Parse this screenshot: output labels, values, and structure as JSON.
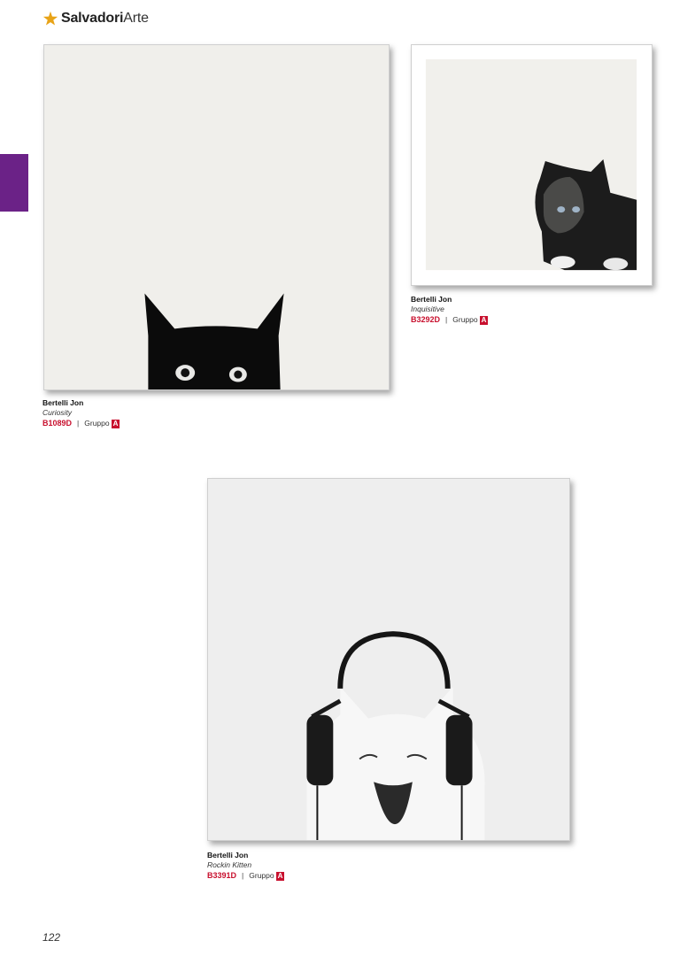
{
  "brand": {
    "name_bold": "Salvadori",
    "name_light": "Arte",
    "mark_icon": "star-icon"
  },
  "colors": {
    "accent": "#c8102e",
    "side_tab": "#6b2287",
    "logo_mark": "#e8a317"
  },
  "artworks": [
    {
      "artist": "Bertelli Jon",
      "title": "Curiosity",
      "code": "B1089D",
      "separator": "|",
      "group_label": "Gruppo",
      "group": "A"
    },
    {
      "artist": "Bertelli Jon",
      "title": "Inquisitive",
      "code": "B3292D",
      "separator": "|",
      "group_label": "Gruppo",
      "group": "A"
    },
    {
      "artist": "Bertelli Jon",
      "title": "Rockin  Kitten",
      "code": "B3391D",
      "separator": "|",
      "group_label": "Gruppo",
      "group": "A"
    }
  ],
  "page_number": "122"
}
